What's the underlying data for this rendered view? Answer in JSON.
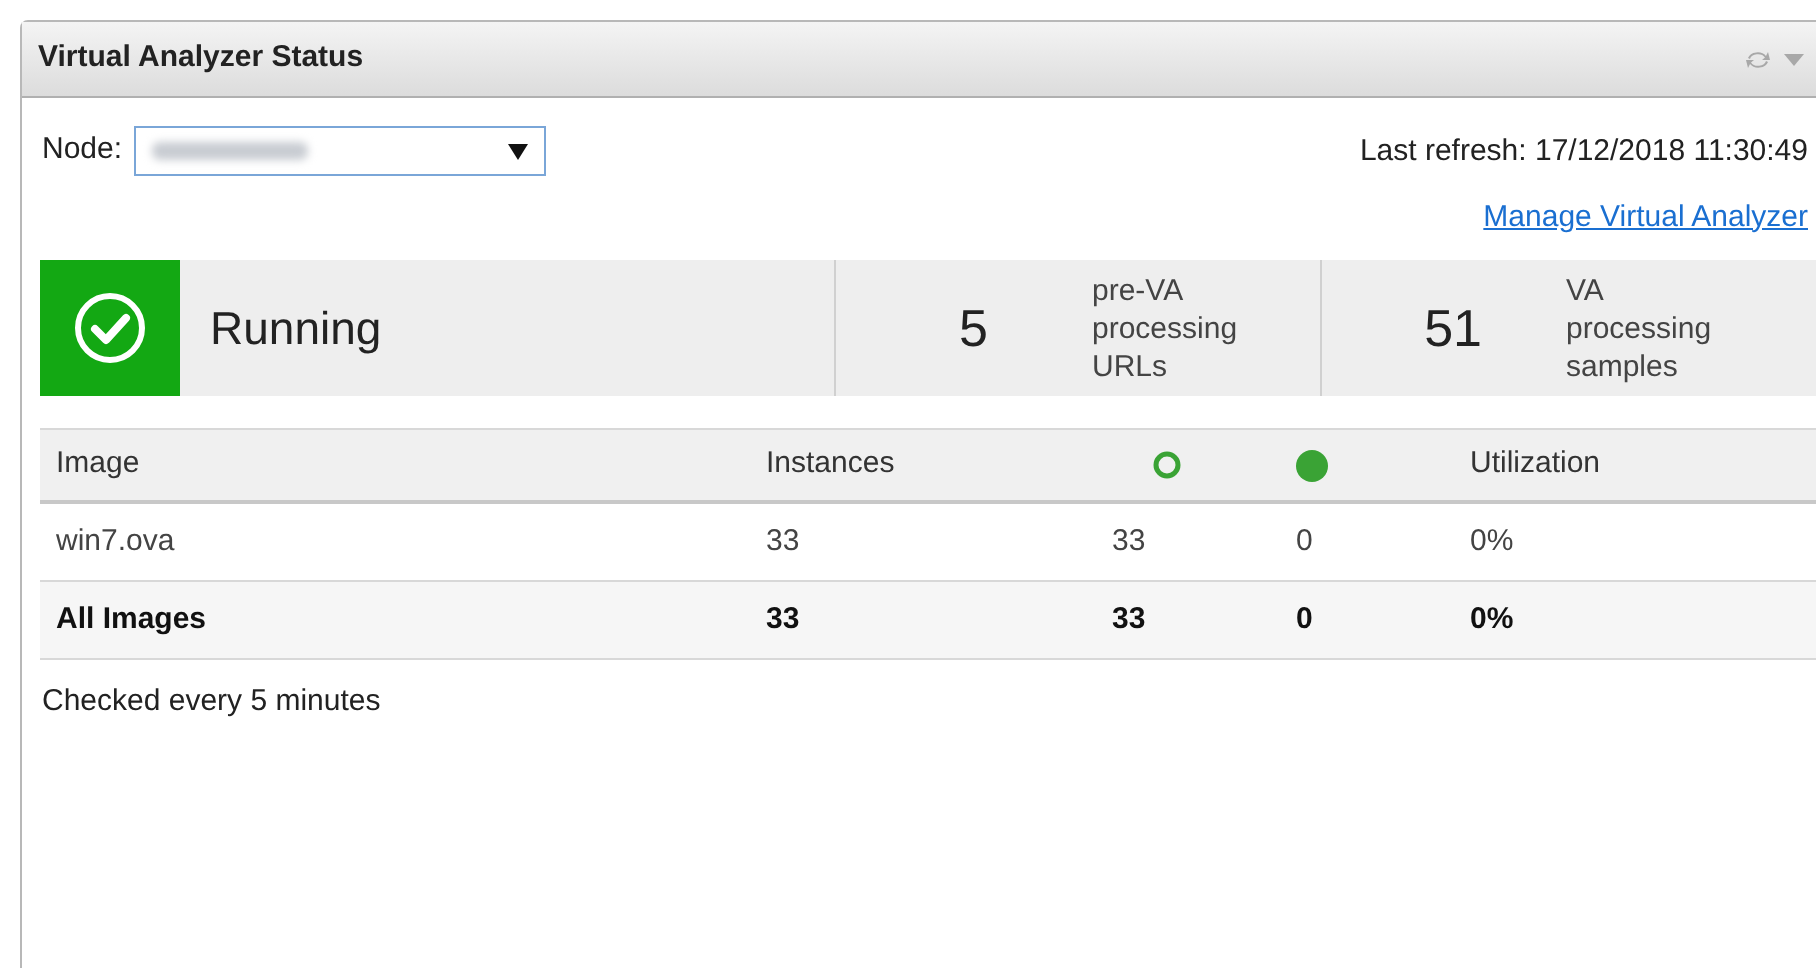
{
  "panel": {
    "title": "Virtual Analyzer Status"
  },
  "node": {
    "label": "Node:"
  },
  "last_refresh": "Last refresh: 17/12/2018 11:30:49",
  "manage_link": "Manage Virtual Analyzer",
  "status": {
    "label": "Running",
    "kind": "running"
  },
  "counters": [
    {
      "value": "5",
      "label": "pre-VA processing URLs"
    },
    {
      "value": "51",
      "label": "VA processing samples"
    }
  ],
  "table": {
    "columns": [
      {
        "kind": "text",
        "label": "Image"
      },
      {
        "kind": "text",
        "label": "Instances"
      },
      {
        "kind": "ring"
      },
      {
        "kind": "dot"
      },
      {
        "kind": "text",
        "label": "Utilization"
      }
    ],
    "rows": [
      {
        "kind": "item",
        "cells": [
          "win7.ova",
          "33",
          "33",
          "0",
          "0%"
        ]
      },
      {
        "kind": "total",
        "cells": [
          "All Images",
          "33",
          "33",
          "0",
          "0%"
        ]
      }
    ]
  },
  "footer": "Checked every 5 minutes"
}
